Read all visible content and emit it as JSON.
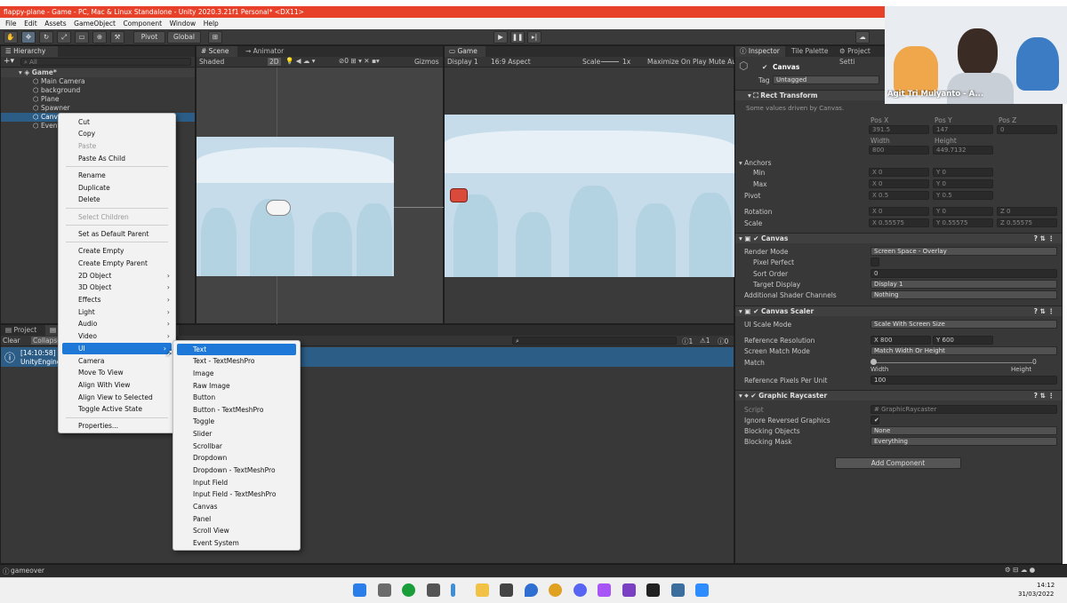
{
  "window": {
    "title": "flappy-plane - Game - PC, Mac & Linux Standalone - Unity 2020.3.21f1 Personal* <DX11>"
  },
  "menu": [
    "File",
    "Edit",
    "Assets",
    "GameObject",
    "Component",
    "Window",
    "Help"
  ],
  "toolbar": {
    "pivot": "Pivot",
    "global": "Global"
  },
  "hierarchy": {
    "tab": "Hierarchy",
    "search_placeholder": "All",
    "items": [
      {
        "label": "Game*"
      },
      {
        "label": "Main Camera"
      },
      {
        "label": "background"
      },
      {
        "label": "Plane"
      },
      {
        "label": "Spawner"
      },
      {
        "label": "Canvas"
      },
      {
        "label": "EventSystem"
      }
    ]
  },
  "scene": {
    "tabs": [
      "Scene",
      "Animator"
    ],
    "shading": "Shaded",
    "mode_2d": "2D",
    "gizmos": "Gizmos",
    "count": "0"
  },
  "game": {
    "tab": "Game",
    "display": "Display 1",
    "aspect": "16:9 Aspect",
    "scale_label": "Scale",
    "scale_value": "1x",
    "maximize": "Maximize On Play",
    "mute": "Mute Au"
  },
  "project": {
    "tabs": [
      "Project"
    ],
    "clear": "Clear",
    "collapse": "Collapse",
    "log_time": "[14:10:58] g",
    "log_source": "UnityEngine",
    "counts": {
      "info": "1",
      "warn": "1",
      "error": "0"
    }
  },
  "inspector": {
    "tabs": [
      "Inspector",
      "Tile Palette",
      "Project Setti"
    ],
    "object_name": "Canvas",
    "tag_label": "Tag",
    "tag_value": "Untagged",
    "rect_transform": {
      "header": "Rect Transform",
      "note": "Some values driven by Canvas.",
      "posx_label": "Pos X",
      "posy_label": "Pos Y",
      "posz_label": "Pos Z",
      "posx": "391.5",
      "posy": "147",
      "posz": "0",
      "width_label": "Width",
      "height_label": "Height",
      "width": "800",
      "height": "449.7132",
      "anchors": "Anchors",
      "min": "Min",
      "max": "Max",
      "min_x": "0",
      "min_y": "0",
      "max_x": "0",
      "max_y": "0",
      "pivot": "Pivot",
      "pivot_x": "0.5",
      "pivot_y": "0.5",
      "rotation": "Rotation",
      "rot_x": "0",
      "rot_y": "0",
      "rot_z": "0",
      "scale": "Scale",
      "scale_x": "0.55575",
      "scale_y": "0.55575",
      "scale_z": "0.55575"
    },
    "canvas": {
      "header": "Canvas",
      "render_mode_label": "Render Mode",
      "render_mode": "Screen Space - Overlay",
      "pixel_perfect": "Pixel Perfect",
      "sort_order_label": "Sort Order",
      "sort_order": "0",
      "target_display_label": "Target Display",
      "target_display": "Display 1",
      "shader_channels_label": "Additional Shader Channels",
      "shader_channels": "Nothing"
    },
    "canvas_scaler": {
      "header": "Canvas Scaler",
      "ui_scale_mode_label": "UI Scale Mode",
      "ui_scale_mode": "Scale With Screen Size",
      "ref_res_label": "Reference Resolution",
      "ref_x": "800",
      "ref_y": "600",
      "screen_match_label": "Screen Match Mode",
      "screen_match": "Match Width Or Height",
      "match_label": "Match",
      "match_value": "0",
      "width": "Width",
      "height": "Height",
      "ref_ppu_label": "Reference Pixels Per Unit",
      "ref_ppu": "100"
    },
    "raycaster": {
      "header": "Graphic Raycaster",
      "script_label": "Script",
      "script": "GraphicRaycaster",
      "ignore_reversed": "Ignore Reversed Graphics",
      "blocking_objects_label": "Blocking Objects",
      "blocking_objects": "None",
      "blocking_mask_label": "Blocking Mask",
      "blocking_mask": "Everything"
    },
    "add_component": "Add Component"
  },
  "context_menu": {
    "items": [
      {
        "label": "Cut",
        "disabled": false
      },
      {
        "label": "Copy",
        "disabled": false
      },
      {
        "label": "Paste",
        "disabled": true
      },
      {
        "label": "Paste As Child",
        "disabled": false
      },
      {
        "label": "Rename",
        "disabled": false
      },
      {
        "label": "Duplicate",
        "disabled": false
      },
      {
        "label": "Delete",
        "disabled": false
      },
      {
        "label": "Select Children",
        "disabled": true
      },
      {
        "label": "Set as Default Parent",
        "disabled": false
      },
      {
        "label": "Create Empty",
        "disabled": false
      },
      {
        "label": "Create Empty Parent",
        "disabled": false
      },
      {
        "label": "2D Object",
        "disabled": false
      },
      {
        "label": "3D Object",
        "disabled": false
      },
      {
        "label": "Effects",
        "disabled": false
      },
      {
        "label": "Light",
        "disabled": false
      },
      {
        "label": "Audio",
        "disabled": false
      },
      {
        "label": "Video",
        "disabled": false
      },
      {
        "label": "UI",
        "disabled": false
      },
      {
        "label": "Camera",
        "disabled": false
      },
      {
        "label": "Move To View",
        "disabled": false
      },
      {
        "label": "Align With View",
        "disabled": false
      },
      {
        "label": "Align View to Selected",
        "disabled": false
      },
      {
        "label": "Toggle Active State",
        "disabled": false
      },
      {
        "label": "Properties...",
        "disabled": false
      }
    ]
  },
  "ui_submenu": {
    "items": [
      "Text",
      "Text - TextMeshPro",
      "Image",
      "Raw Image",
      "Button",
      "Button - TextMeshPro",
      "Toggle",
      "Slider",
      "Scrollbar",
      "Dropdown",
      "Dropdown - TextMeshPro",
      "Input Field",
      "Input Field - TextMeshPro",
      "Canvas",
      "Panel",
      "Scroll View",
      "Event System"
    ]
  },
  "statusbar": {
    "message": "gameover"
  },
  "webcam": {
    "name": "Agit Tri Mulyanto - A..."
  },
  "taskbar": {
    "time": "14:12",
    "date": "31/03/2022"
  },
  "colors": {
    "accent": "#e8412a",
    "selection": "#2c5d87",
    "menu_highlight": "#1e78d7"
  }
}
